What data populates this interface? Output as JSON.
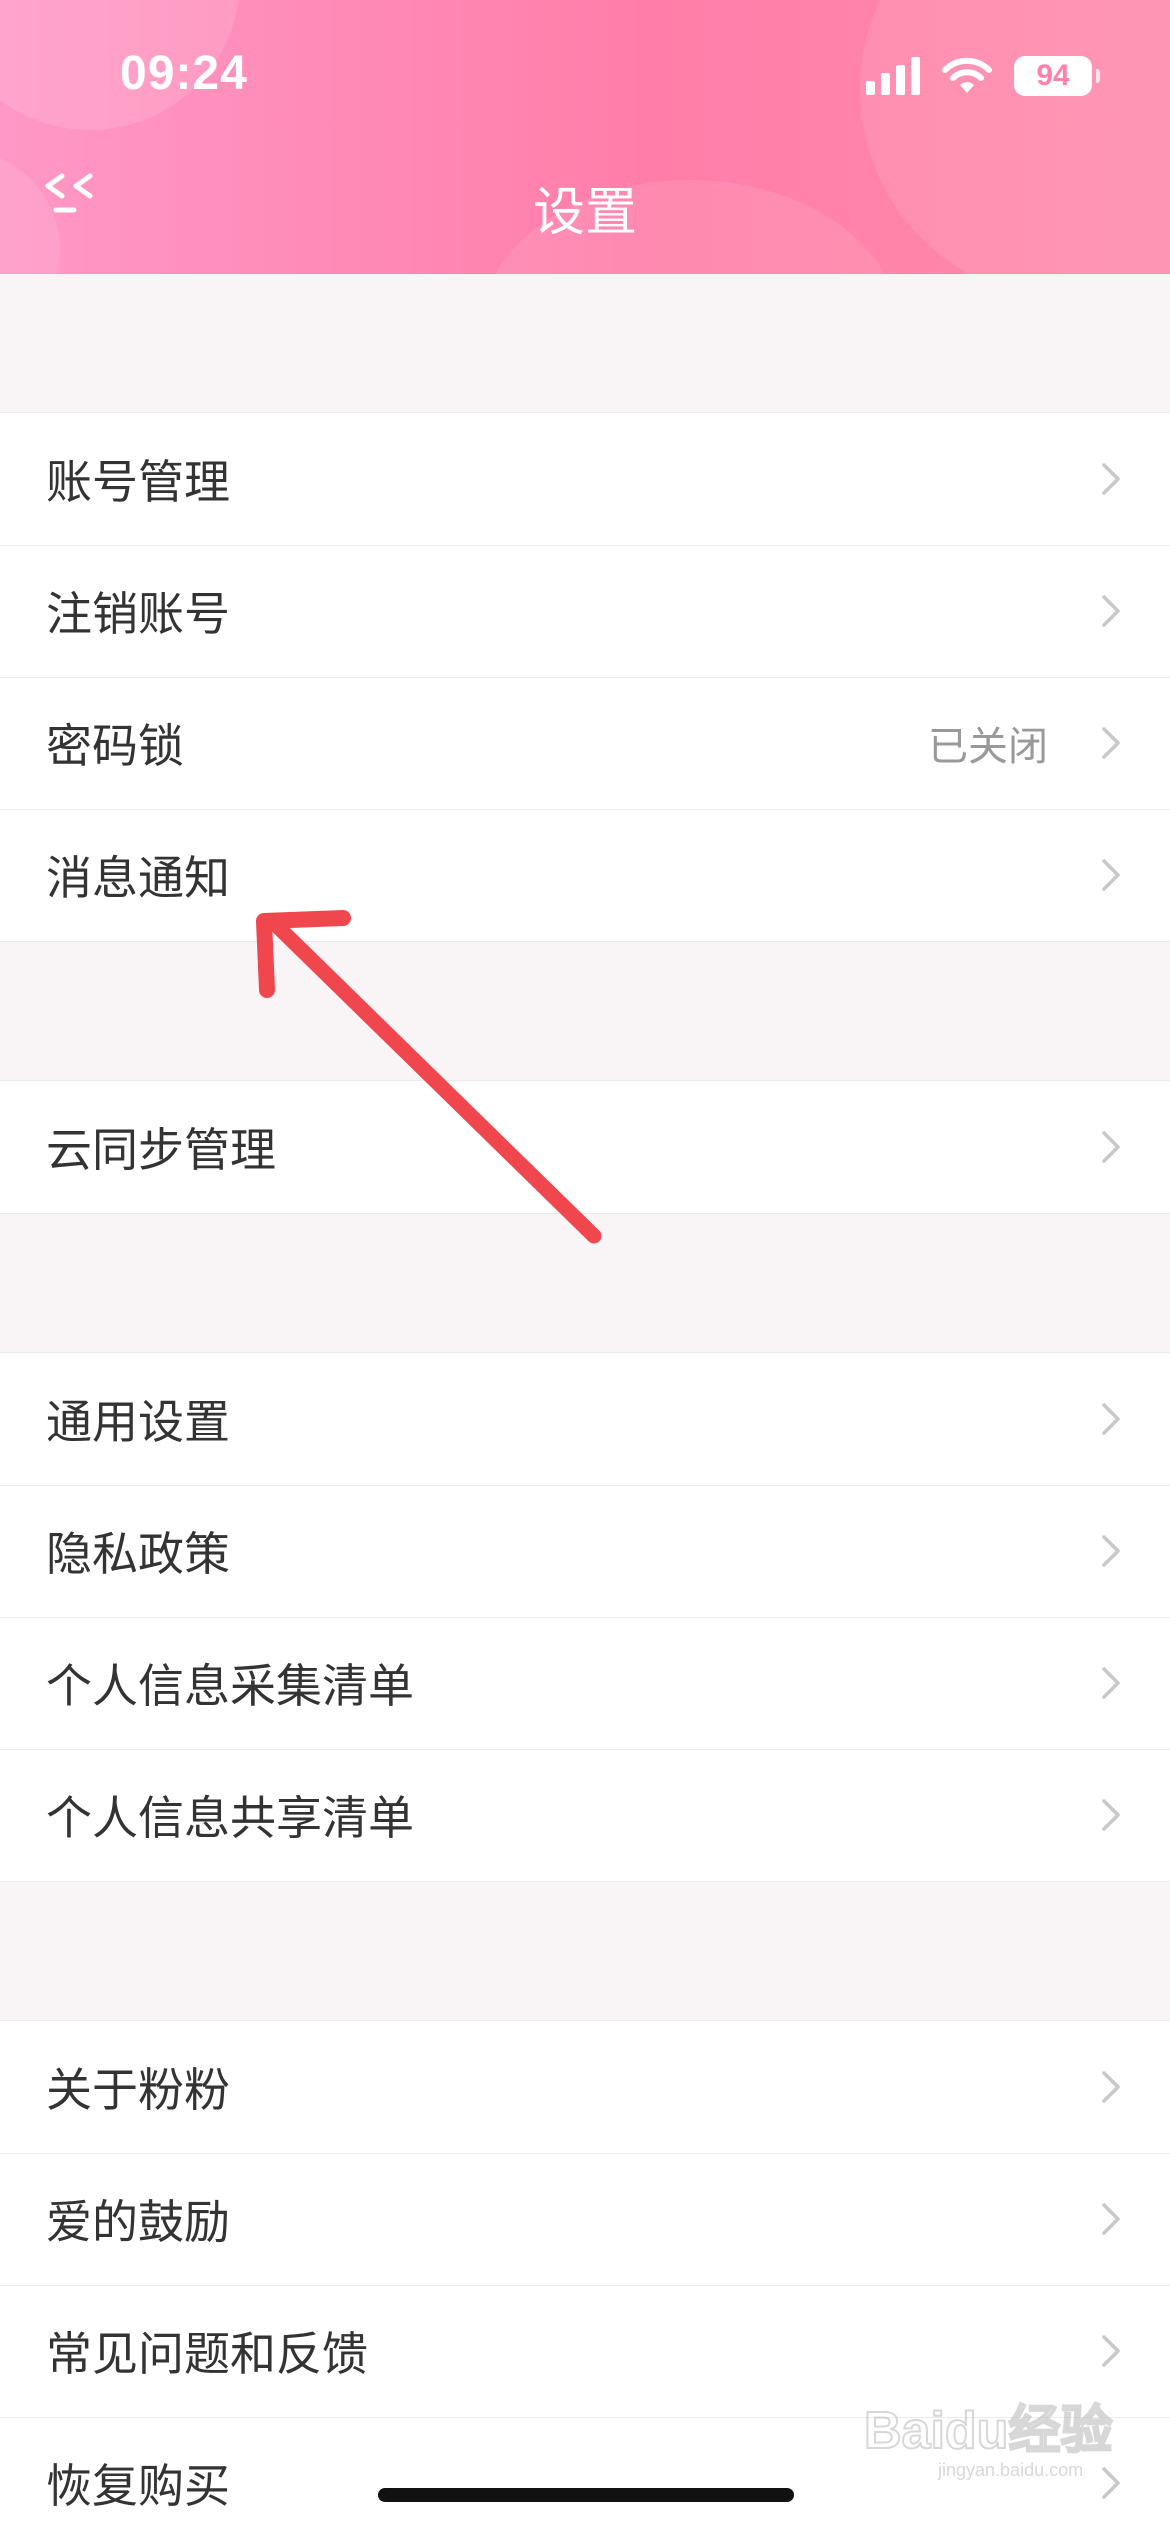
{
  "status_bar": {
    "time": "09:24",
    "battery": "94"
  },
  "nav": {
    "title": "设置",
    "back_icon": "double-chevron-left-icon"
  },
  "groups": [
    {
      "items": [
        {
          "label": "账号管理",
          "value": ""
        },
        {
          "label": "注销账号",
          "value": ""
        },
        {
          "label": "密码锁",
          "value": "已关闭"
        },
        {
          "label": "消息通知",
          "value": ""
        }
      ]
    },
    {
      "items": [
        {
          "label": "云同步管理",
          "value": ""
        }
      ]
    },
    {
      "items": [
        {
          "label": "通用设置",
          "value": ""
        },
        {
          "label": "隐私政策",
          "value": ""
        },
        {
          "label": "个人信息采集清单",
          "value": ""
        },
        {
          "label": "个人信息共享清单",
          "value": ""
        }
      ]
    },
    {
      "items": [
        {
          "label": "关于粉粉",
          "value": ""
        },
        {
          "label": "爱的鼓励",
          "value": ""
        },
        {
          "label": "常见问题和反馈",
          "value": ""
        },
        {
          "label": "恢复购买",
          "value": ""
        }
      ]
    }
  ],
  "watermark": {
    "text": "Baidu经验",
    "sub": "jingyan.baidu.com"
  },
  "colors": {
    "header_start": "#ff98c6",
    "header_end": "#ff7ea9",
    "annotation_arrow": "#f0474f"
  }
}
